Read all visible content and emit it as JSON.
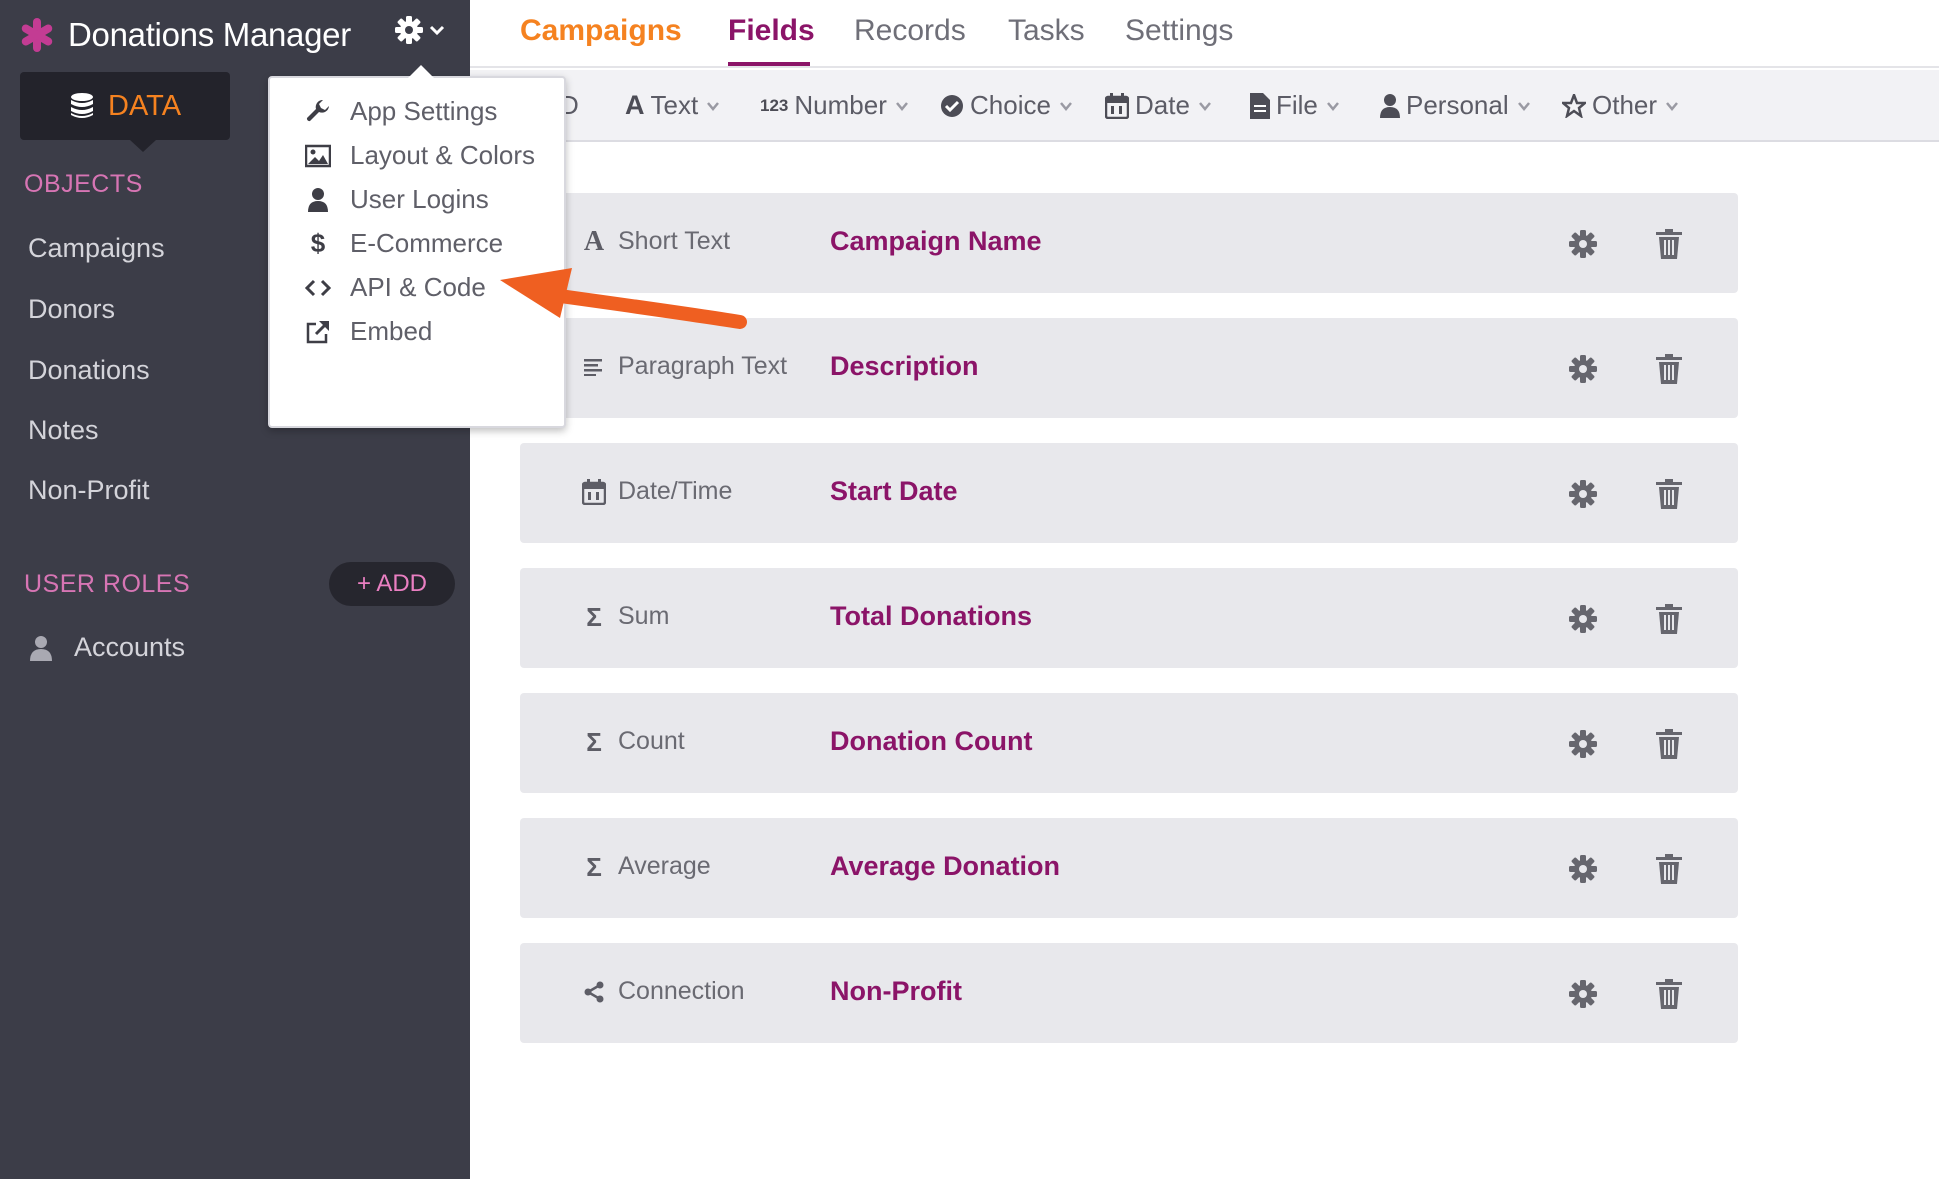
{
  "app": {
    "title": "Donations Manager"
  },
  "sidebar": {
    "data_tab_label": "DATA",
    "objects_heading": "OBJECTS",
    "objects": [
      "Campaigns",
      "Donors",
      "Donations",
      "Notes",
      "Non-Profit"
    ],
    "user_roles_heading": "USER ROLES",
    "add_button_label": "+ ADD",
    "roles": [
      "Accounts"
    ]
  },
  "topnav": {
    "object_name": "Campaigns",
    "tabs": [
      "Fields",
      "Records",
      "Tasks",
      "Settings"
    ],
    "active_tab": "Fields"
  },
  "field_toolbar": {
    "clipped_label": "D",
    "items": [
      "Text",
      "Number",
      "Choice",
      "Date",
      "File",
      "Personal",
      "Other"
    ]
  },
  "fields": [
    {
      "type": "Short Text",
      "name": "Campaign Name",
      "icon": "letter-a-icon"
    },
    {
      "type": "Paragraph Text",
      "name": "Description",
      "icon": "align-left-icon"
    },
    {
      "type": "Date/Time",
      "name": "Start Date",
      "icon": "calendar-icon"
    },
    {
      "type": "Sum",
      "name": "Total Donations",
      "icon": "sigma-icon"
    },
    {
      "type": "Count",
      "name": "Donation Count",
      "icon": "sigma-icon"
    },
    {
      "type": "Average",
      "name": "Average Donation",
      "icon": "sigma-icon"
    },
    {
      "type": "Connection",
      "name": "Non-Profit",
      "icon": "share-icon"
    }
  ],
  "dropdown": {
    "items": [
      "App Settings",
      "Layout & Colors",
      "User Logins",
      "E-Commerce",
      "API & Code",
      "Embed"
    ]
  },
  "colors": {
    "sidebar_bg": "#3c3d48",
    "accent_orange": "#f58220",
    "accent_magenta": "#8b1468",
    "sidebar_heading_pink": "#d775b4",
    "annotation_arrow": "#ef5f21"
  }
}
